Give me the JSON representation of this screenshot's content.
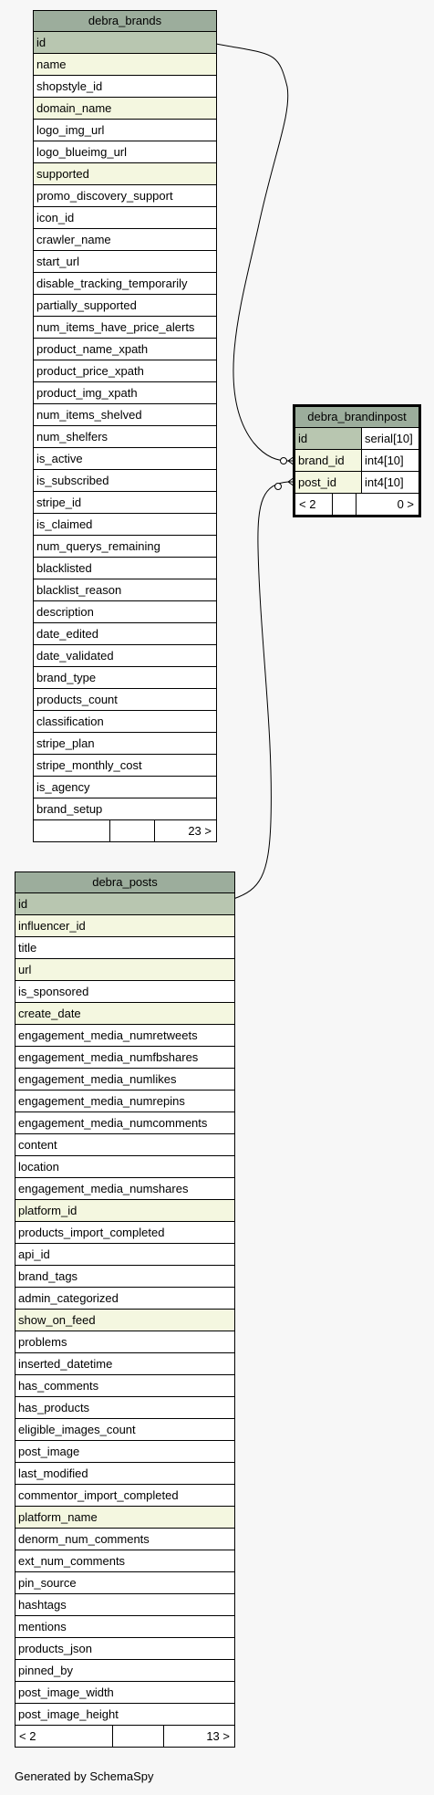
{
  "tables": {
    "brands": {
      "name": "debra_brands",
      "footer": {
        "left": "",
        "right": "23 >"
      },
      "columns": [
        {
          "name": "id",
          "kind": "pk"
        },
        {
          "name": "name",
          "kind": "fk"
        },
        {
          "name": "shopstyle_id",
          "kind": "plain"
        },
        {
          "name": "domain_name",
          "kind": "fk"
        },
        {
          "name": "logo_img_url",
          "kind": "plain"
        },
        {
          "name": "logo_blueimg_url",
          "kind": "plain"
        },
        {
          "name": "supported",
          "kind": "fk"
        },
        {
          "name": "promo_discovery_support",
          "kind": "plain"
        },
        {
          "name": "icon_id",
          "kind": "plain"
        },
        {
          "name": "crawler_name",
          "kind": "plain"
        },
        {
          "name": "start_url",
          "kind": "plain"
        },
        {
          "name": "disable_tracking_temporarily",
          "kind": "plain"
        },
        {
          "name": "partially_supported",
          "kind": "plain"
        },
        {
          "name": "num_items_have_price_alerts",
          "kind": "plain"
        },
        {
          "name": "product_name_xpath",
          "kind": "plain"
        },
        {
          "name": "product_price_xpath",
          "kind": "plain"
        },
        {
          "name": "product_img_xpath",
          "kind": "plain"
        },
        {
          "name": "num_items_shelved",
          "kind": "plain"
        },
        {
          "name": "num_shelfers",
          "kind": "plain"
        },
        {
          "name": "is_active",
          "kind": "plain"
        },
        {
          "name": "is_subscribed",
          "kind": "plain"
        },
        {
          "name": "stripe_id",
          "kind": "plain"
        },
        {
          "name": "is_claimed",
          "kind": "plain"
        },
        {
          "name": "num_querys_remaining",
          "kind": "plain"
        },
        {
          "name": "blacklisted",
          "kind": "plain"
        },
        {
          "name": "blacklist_reason",
          "kind": "plain"
        },
        {
          "name": "description",
          "kind": "plain"
        },
        {
          "name": "date_edited",
          "kind": "plain"
        },
        {
          "name": "date_validated",
          "kind": "plain"
        },
        {
          "name": "brand_type",
          "kind": "plain"
        },
        {
          "name": "products_count",
          "kind": "plain"
        },
        {
          "name": "classification",
          "kind": "plain"
        },
        {
          "name": "stripe_plan",
          "kind": "plain"
        },
        {
          "name": "stripe_monthly_cost",
          "kind": "plain"
        },
        {
          "name": "is_agency",
          "kind": "plain"
        },
        {
          "name": "brand_setup",
          "kind": "plain"
        }
      ]
    },
    "brandinpost": {
      "name": "debra_brandinpost",
      "footer": {
        "left": "< 2",
        "right": "0 >"
      },
      "columns": [
        {
          "name": "id",
          "type": "serial[10]",
          "kind": "pk"
        },
        {
          "name": "brand_id",
          "type": "int4[10]",
          "kind": "fk"
        },
        {
          "name": "post_id",
          "type": "int4[10]",
          "kind": "fk"
        }
      ]
    },
    "posts": {
      "name": "debra_posts",
      "footer": {
        "left": "< 2",
        "right": "13 >"
      },
      "columns": [
        {
          "name": "id",
          "kind": "pk"
        },
        {
          "name": "influencer_id",
          "kind": "fk"
        },
        {
          "name": "title",
          "kind": "plain"
        },
        {
          "name": "url",
          "kind": "fk"
        },
        {
          "name": "is_sponsored",
          "kind": "plain"
        },
        {
          "name": "create_date",
          "kind": "fk"
        },
        {
          "name": "engagement_media_numretweets",
          "kind": "plain"
        },
        {
          "name": "engagement_media_numfbshares",
          "kind": "plain"
        },
        {
          "name": "engagement_media_numlikes",
          "kind": "plain"
        },
        {
          "name": "engagement_media_numrepins",
          "kind": "plain"
        },
        {
          "name": "engagement_media_numcomments",
          "kind": "plain"
        },
        {
          "name": "content",
          "kind": "plain"
        },
        {
          "name": "location",
          "kind": "plain"
        },
        {
          "name": "engagement_media_numshares",
          "kind": "plain"
        },
        {
          "name": "platform_id",
          "kind": "fk"
        },
        {
          "name": "products_import_completed",
          "kind": "plain"
        },
        {
          "name": "api_id",
          "kind": "plain"
        },
        {
          "name": "brand_tags",
          "kind": "plain"
        },
        {
          "name": "admin_categorized",
          "kind": "plain"
        },
        {
          "name": "show_on_feed",
          "kind": "fk"
        },
        {
          "name": "problems",
          "kind": "plain"
        },
        {
          "name": "inserted_datetime",
          "kind": "plain"
        },
        {
          "name": "has_comments",
          "kind": "plain"
        },
        {
          "name": "has_products",
          "kind": "plain"
        },
        {
          "name": "eligible_images_count",
          "kind": "plain"
        },
        {
          "name": "post_image",
          "kind": "plain"
        },
        {
          "name": "last_modified",
          "kind": "plain"
        },
        {
          "name": "commentor_import_completed",
          "kind": "plain"
        },
        {
          "name": "platform_name",
          "kind": "fk"
        },
        {
          "name": "denorm_num_comments",
          "kind": "plain"
        },
        {
          "name": "ext_num_comments",
          "kind": "plain"
        },
        {
          "name": "pin_source",
          "kind": "plain"
        },
        {
          "name": "hashtags",
          "kind": "plain"
        },
        {
          "name": "mentions",
          "kind": "plain"
        },
        {
          "name": "products_json",
          "kind": "plain"
        },
        {
          "name": "pinned_by",
          "kind": "plain"
        },
        {
          "name": "post_image_width",
          "kind": "plain"
        },
        {
          "name": "post_image_height",
          "kind": "plain"
        }
      ]
    }
  },
  "relationships": [
    {
      "from": "debra_brands.id",
      "to": "debra_brandinpost.brand_id"
    },
    {
      "from": "debra_posts.id",
      "to": "debra_brandinpost.post_id"
    }
  ],
  "footer_text": "Generated by SchemaSpy"
}
